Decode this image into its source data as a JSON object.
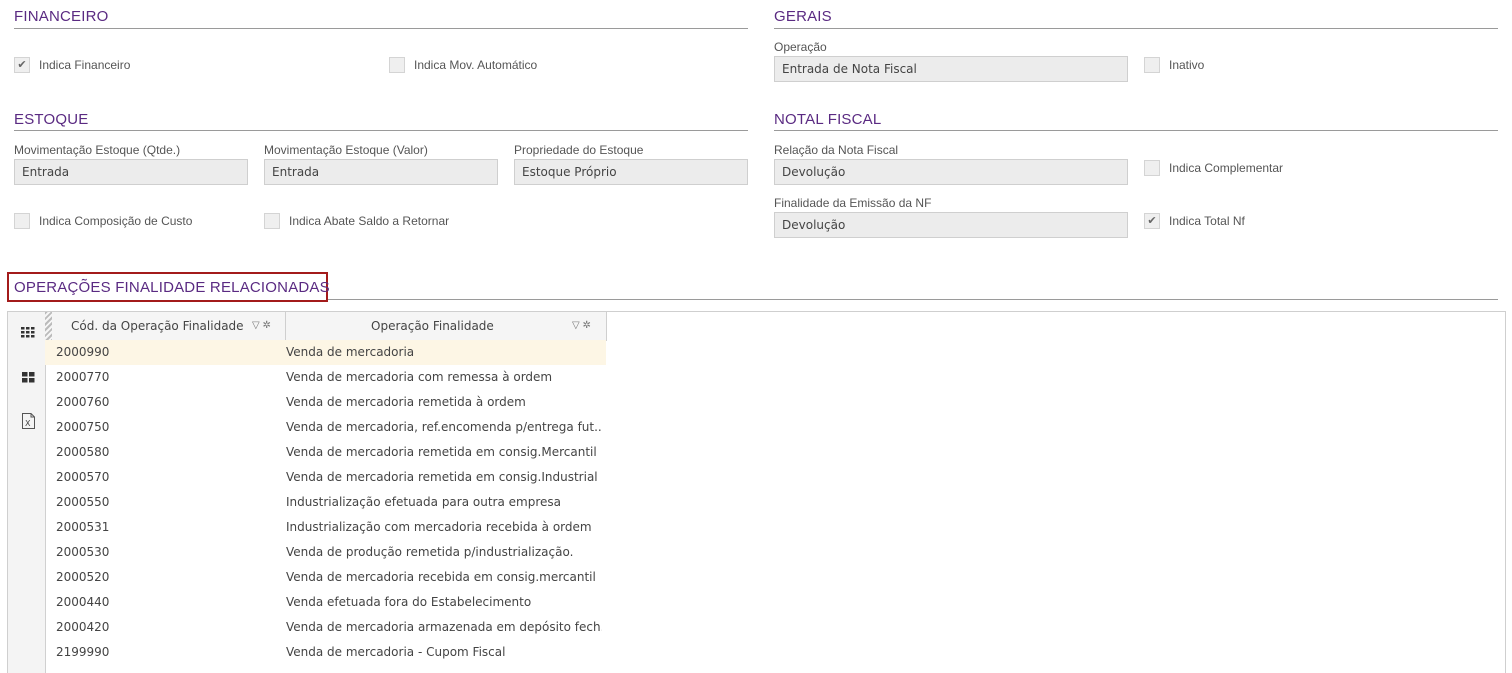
{
  "financeiro": {
    "title": "FINANCEIRO",
    "indica_financeiro": {
      "label": "Indica Financeiro",
      "checked": true
    },
    "indica_mov_automatico": {
      "label": "Indica Mov. Automático",
      "checked": false
    }
  },
  "gerais": {
    "title": "GERAIS",
    "operacao_label": "Operação",
    "operacao_value": "Entrada de Nota Fiscal",
    "inativo": {
      "label": "Inativo",
      "checked": false
    }
  },
  "estoque": {
    "title": "ESTOQUE",
    "mov_qtde_label": "Movimentação Estoque (Qtde.)",
    "mov_qtde_value": "Entrada",
    "mov_valor_label": "Movimentação Estoque (Valor)",
    "mov_valor_value": "Entrada",
    "propriedade_label": "Propriedade do Estoque",
    "propriedade_value": "Estoque Próprio",
    "indica_composicao": {
      "label": "Indica Composição de Custo",
      "checked": false
    },
    "indica_abate": {
      "label": "Indica Abate Saldo a Retornar",
      "checked": false
    }
  },
  "nota_fiscal": {
    "title": "NOTAL FISCAL",
    "relacao_label": "Relação da Nota Fiscal",
    "relacao_value": "Devolução",
    "finalidade_label": "Finalidade da Emissão da NF",
    "finalidade_value": "Devolução",
    "indica_complementar": {
      "label": "Indica Complementar",
      "checked": false
    },
    "indica_total_nf": {
      "label": "Indica Total Nf",
      "checked": true
    }
  },
  "related": {
    "title": "OPERAÇÕES FINALIDADE RELACIONADAS",
    "toolbar_icons": [
      "grid-view-icon",
      "card-view-icon",
      "excel-export-icon"
    ],
    "columns": [
      "Cód. da Operação Finalidade",
      "Operação Finalidade"
    ],
    "rows": [
      {
        "code": "2000990",
        "desc": "Venda de mercadoria",
        "selected": true
      },
      {
        "code": "2000770",
        "desc": "Venda de mercadoria com remessa à ordem"
      },
      {
        "code": "2000760",
        "desc": "Venda de mercadoria remetida à ordem"
      },
      {
        "code": "2000750",
        "desc": "Venda de mercadoria, ref.encomenda p/entrega fut..."
      },
      {
        "code": "2000580",
        "desc": "Venda de mercadoria remetida em consig.Mercantil"
      },
      {
        "code": "2000570",
        "desc": "Venda de mercadoria remetida em consig.Industrial"
      },
      {
        "code": "2000550",
        "desc": "Industrialização efetuada para outra empresa"
      },
      {
        "code": "2000531",
        "desc": "Industrialização com mercadoria recebida à ordem"
      },
      {
        "code": "2000530",
        "desc": "Venda de produção remetida p/industrialização."
      },
      {
        "code": "2000520",
        "desc": "Venda de mercadoria recebida em consig.mercantil"
      },
      {
        "code": "2000440",
        "desc": "Venda efetuada fora do Estabelecimento"
      },
      {
        "code": "2000420",
        "desc": "Venda de mercadoria armazenada em depósito fech..."
      },
      {
        "code": "2199990",
        "desc": "Venda de mercadoria - Cupom Fiscal"
      }
    ]
  },
  "colors": {
    "section_title": "#5a2a82",
    "highlight_border": "#a31b1b",
    "selected_row": "#fdf6e5"
  }
}
